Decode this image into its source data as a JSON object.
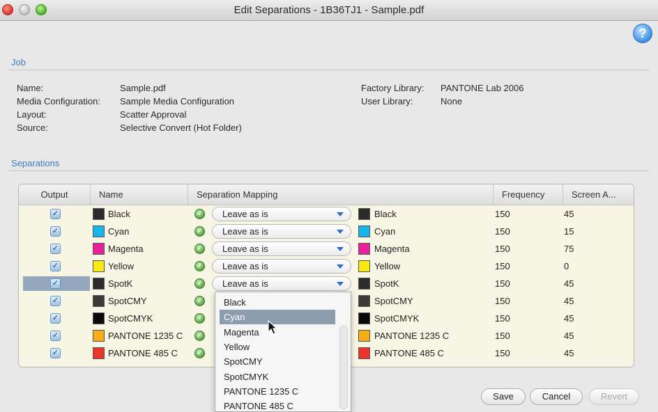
{
  "window": {
    "title": "Edit Separations - 1B36TJ1 - Sample.pdf"
  },
  "help": {
    "glyph": "?"
  },
  "job": {
    "section_label": "Job",
    "left": [
      {
        "label": "Name:",
        "value": "Sample.pdf"
      },
      {
        "label": "Media Configuration:",
        "value": "Sample Media Configuration"
      },
      {
        "label": "Layout:",
        "value": "Scatter Approval"
      },
      {
        "label": "Source:",
        "value": "Selective Convert (Hot Folder)"
      }
    ],
    "right": [
      {
        "label": "Factory Library:",
        "value": "PANTONE Lab 2006"
      },
      {
        "label": "User Library:",
        "value": "None"
      }
    ]
  },
  "separations": {
    "section_label": "Separations",
    "columns": [
      "Output",
      "Name",
      "Separation Mapping",
      "Frequency",
      "Screen A..."
    ],
    "rows": [
      {
        "output": true,
        "name": "Black",
        "swatch": "#2b2b2b",
        "mapping": "Leave as is",
        "target": "Black",
        "target_swatch": "#2b2b2b",
        "frequency": "150",
        "angle": "45"
      },
      {
        "output": true,
        "name": "Cyan",
        "swatch": "#19b5ea",
        "mapping": "Leave as is",
        "target": "Cyan",
        "target_swatch": "#19b5ea",
        "frequency": "150",
        "angle": "15"
      },
      {
        "output": true,
        "name": "Magenta",
        "swatch": "#e8209a",
        "mapping": "Leave as is",
        "target": "Magenta",
        "target_swatch": "#e8209a",
        "frequency": "150",
        "angle": "75"
      },
      {
        "output": true,
        "name": "Yellow",
        "swatch": "#f6ea12",
        "mapping": "Leave as is",
        "target": "Yellow",
        "target_swatch": "#f6ea12",
        "frequency": "150",
        "angle": "0"
      },
      {
        "output": true,
        "name": "SpotK",
        "swatch": "#2b2b2b",
        "mapping": "Leave as is",
        "target": "SpotK",
        "target_swatch": "#2b2b2b",
        "frequency": "150",
        "angle": "45"
      },
      {
        "output": true,
        "name": "SpotCMY",
        "swatch": "#3a3a36",
        "mapping": "",
        "target": "SpotCMY",
        "target_swatch": "#3a3a36",
        "frequency": "150",
        "angle": "45"
      },
      {
        "output": true,
        "name": "SpotCMYK",
        "swatch": "#0a0a0a",
        "mapping": "",
        "target": "SpotCMYK",
        "target_swatch": "#0a0a0a",
        "frequency": "150",
        "angle": "45"
      },
      {
        "output": true,
        "name": "PANTONE 1235 C",
        "swatch": "#f7ad17",
        "mapping": "",
        "target": "PANTONE 1235 C",
        "target_swatch": "#f7ad17",
        "frequency": "150",
        "angle": "45"
      },
      {
        "output": true,
        "name": "PANTONE 485 C",
        "swatch": "#e8342a",
        "mapping": "",
        "target": "PANTONE 485 C",
        "target_swatch": "#e8342a",
        "frequency": "150",
        "angle": "45"
      }
    ]
  },
  "dropdown": {
    "options": [
      "Black",
      "Cyan",
      "Magenta",
      "Yellow",
      "SpotCMY",
      "SpotCMYK",
      "PANTONE 1235 C",
      "PANTONE 485 C"
    ],
    "highlighted": "Cyan"
  },
  "buttons": {
    "save": "Save",
    "cancel": "Cancel",
    "revert": "Revert"
  },
  "colors": {
    "accent": "#3b7bbf",
    "table_bg": "#f7f5e4",
    "highlight": "#8d9db0"
  }
}
